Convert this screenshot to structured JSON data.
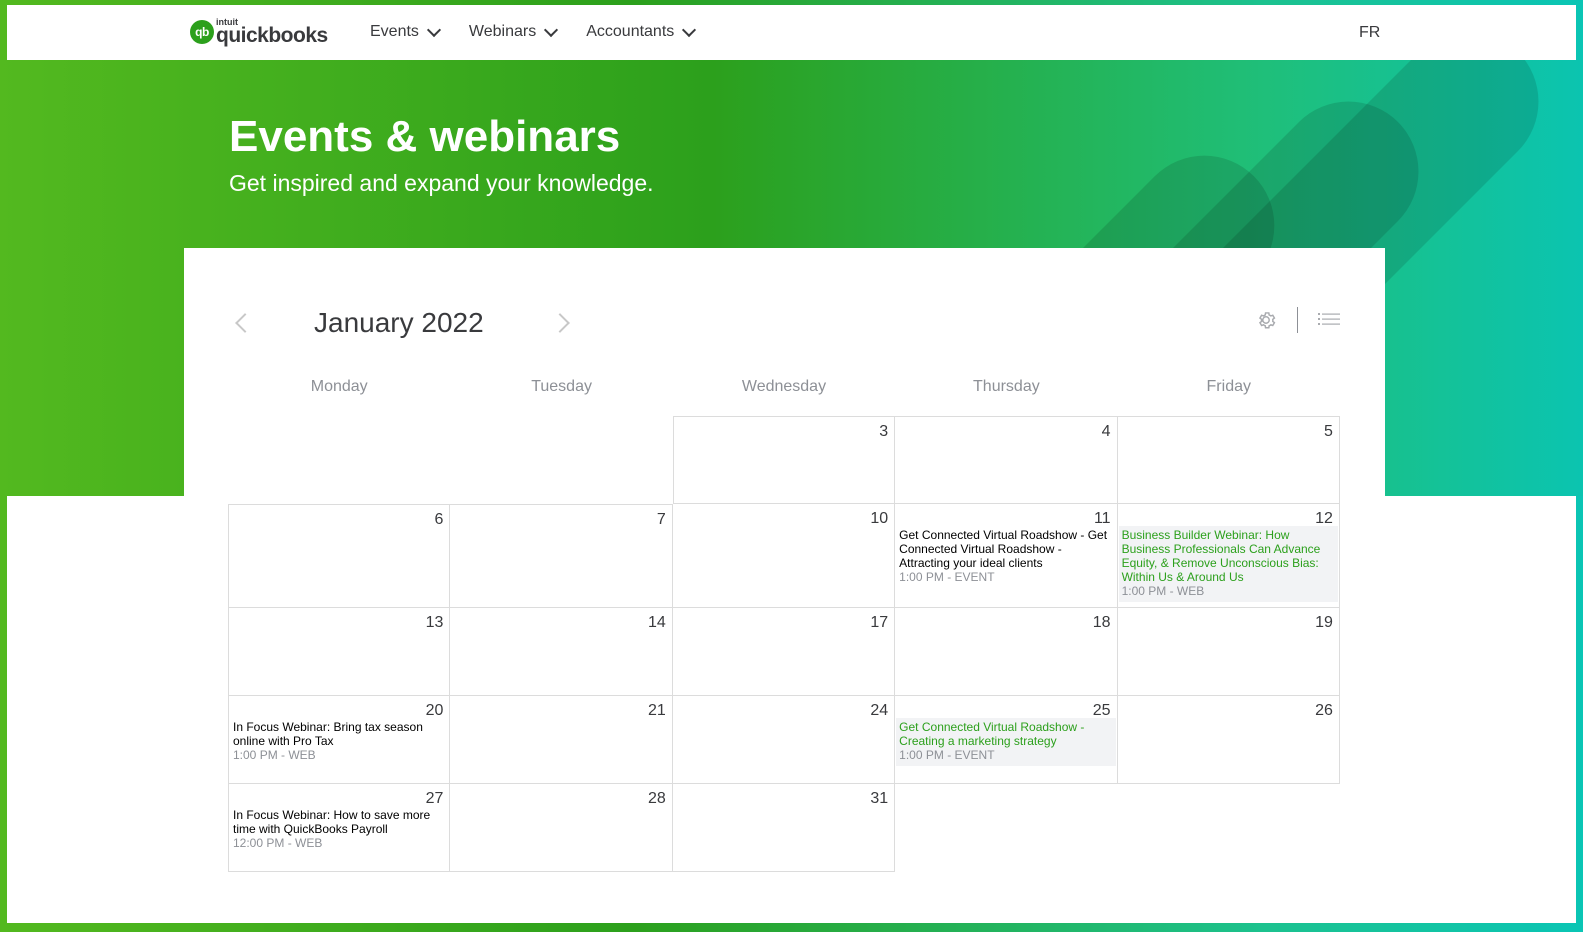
{
  "brand": {
    "intuit": "intuit",
    "name": "quickbooks",
    "mark": "qb",
    "color": "#2ca01c"
  },
  "nav": {
    "items": [
      {
        "label": "Events"
      },
      {
        "label": "Webinars"
      },
      {
        "label": "Accountants"
      }
    ],
    "lang": "FR"
  },
  "hero": {
    "title": "Events & webinars",
    "subtitle": "Get inspired and expand your knowledge."
  },
  "calendar": {
    "month_label": "January 2022",
    "weekdays": [
      "Monday",
      "Tuesday",
      "Wednesday",
      "Thursday",
      "Friday"
    ],
    "weeks": [
      {
        "days": [
          {
            "num": ""
          },
          {
            "num": ""
          },
          {
            "num": "3"
          },
          {
            "num": "4"
          },
          {
            "num": "5"
          }
        ]
      },
      {
        "days": [
          {
            "num": "6"
          },
          {
            "num": "7"
          },
          {
            "num": "10"
          },
          {
            "num": "11",
            "event": {
              "title": "Get Connected Virtual Roadshow - Get Connected Virtual Roadshow - Attracting your ideal clients",
              "meta": "1:00 PM - EVENT"
            }
          },
          {
            "num": "12",
            "event": {
              "title": "Business Builder Webinar: How Business Professionals Can Advance Equity, & Remove Unconscious Bias: Within Us & Around Us",
              "meta": "1:00 PM - WEB",
              "highlight": true
            }
          }
        ]
      },
      {
        "days": [
          {
            "num": "13"
          },
          {
            "num": "14"
          },
          {
            "num": "17"
          },
          {
            "num": "18"
          },
          {
            "num": "19"
          }
        ]
      },
      {
        "days": [
          {
            "num": "20",
            "event": {
              "title": "In Focus Webinar: Bring tax season online with Pro Tax",
              "meta": "1:00 PM - WEB"
            }
          },
          {
            "num": "21"
          },
          {
            "num": "24"
          },
          {
            "num": "25",
            "event": {
              "title": "Get Connected Virtual Roadshow - Creating a marketing strategy",
              "meta": "1:00 PM - EVENT",
              "highlight": true
            }
          },
          {
            "num": "26"
          }
        ]
      },
      {
        "days": [
          {
            "num": "27",
            "event": {
              "title": "In Focus Webinar: How to save more time with QuickBooks Payroll",
              "meta": "12:00 PM - WEB"
            }
          },
          {
            "num": "28"
          },
          {
            "num": "31"
          },
          {
            "num": ""
          },
          {
            "num": ""
          }
        ]
      }
    ]
  },
  "icons": {
    "prev": "chevron-left-icon",
    "next": "chevron-right-icon",
    "settings": "gear-icon",
    "list_view": "list-icon"
  }
}
